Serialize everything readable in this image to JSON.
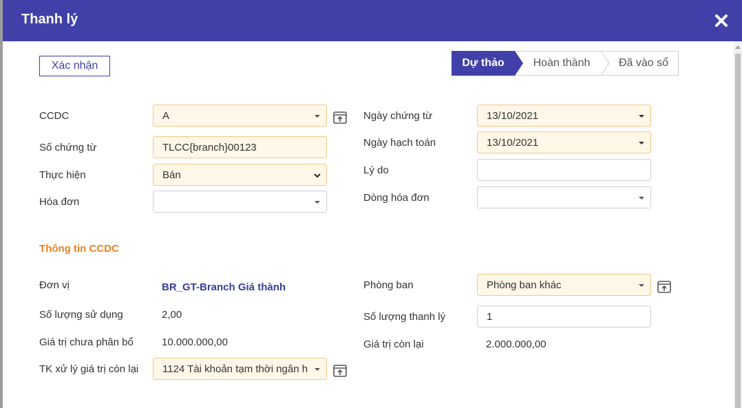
{
  "dialog": {
    "title": "Thanh lý",
    "close_icon": "close-icon",
    "confirm_label": "Xác nhận"
  },
  "status_steps": [
    {
      "label": "Dự thảo",
      "active": true
    },
    {
      "label": "Hoàn thành",
      "active": false
    },
    {
      "label": "Đã vào sổ",
      "active": false
    }
  ],
  "form": {
    "ccdc": {
      "label": "CCDC",
      "value": "A"
    },
    "so_chung_tu": {
      "label": "Số chứng từ",
      "value": "TLCC{branch}00123"
    },
    "thuc_hien": {
      "label": "Thực hiện",
      "value": "Bán"
    },
    "hoa_don": {
      "label": "Hóa đơn",
      "value": ""
    },
    "ngay_chung_tu": {
      "label": "Ngày chứng từ",
      "value": "13/10/2021"
    },
    "ngay_hach_toan": {
      "label": "Ngày hạch toán",
      "value": "13/10/2021"
    },
    "ly_do": {
      "label": "Lý do",
      "value": ""
    },
    "dong_hoa_don": {
      "label": "Dòng hóa đơn",
      "value": ""
    }
  },
  "ccdc_info": {
    "section_title": "Thông tin CCDC",
    "don_vi": {
      "label": "Đơn vị",
      "value": "BR_GT-Branch Giá thành"
    },
    "so_luong_su_dung": {
      "label": "Số lượng sử dụng",
      "value": "2,00"
    },
    "gia_tri_chua_phan_bo": {
      "label": "Giá trị chưa phân bổ",
      "value": "10.000.000,00"
    },
    "tk_xu_ly": {
      "label": "TK xử lý giá trị còn lại",
      "value": "1124 Tài khoản tạm thời ngân h"
    },
    "phong_ban": {
      "label": "Phòng ban",
      "value": "Phòng ban khác"
    },
    "so_luong_thanh_ly": {
      "label": "Số lượng thanh lý",
      "value": "1"
    },
    "gia_tri_con_lai": {
      "label": "Giá trị còn lại",
      "value": "2.000.000,00"
    }
  },
  "colors": {
    "header": "#4040a8",
    "accent": "#e8811e",
    "required_field_bg": "#fff7e8"
  }
}
